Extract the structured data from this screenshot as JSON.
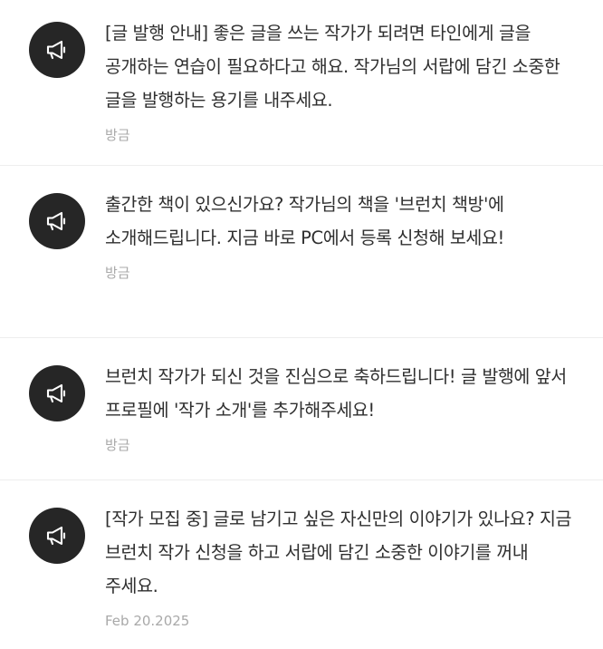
{
  "notifications": [
    {
      "icon": "megaphone-icon",
      "text": "[글 발행 안내] 좋은 글을 쓰는 작가가 되려면 타인에게 글을 공개하는 연습이 필요하다고 해요. 작가님의 서랍에 담긴 소중한 글을 발행하는 용기를 내주세요.",
      "time": "방금"
    },
    {
      "icon": "megaphone-icon",
      "text": "출간한 책이 있으신가요? 작가님의 책을 '브런치 책방'에 소개해드립니다. 지금 바로 PC에서 등록 신청해 보세요!",
      "time": "방금"
    },
    {
      "icon": "megaphone-icon",
      "text": "브런치 작가가 되신 것을 진심으로 축하드립니다! 글 발행에 앞서 프로필에 '작가 소개'를 추가해주세요!",
      "time": "방금"
    },
    {
      "icon": "megaphone-icon",
      "text": "[작가 모집 중] 글로 남기고 싶은 자신만의 이야기가 있나요? 지금 브런치 작가 신청을 하고 서랍에 담긴 소중한 이야기를 꺼내 주세요.",
      "time": "Feb 20.2025"
    }
  ],
  "colors": {
    "avatar_bg": "#262626",
    "text": "#2f2f2f",
    "timestamp": "#a9a9a9",
    "divider": "#eeeeee"
  }
}
